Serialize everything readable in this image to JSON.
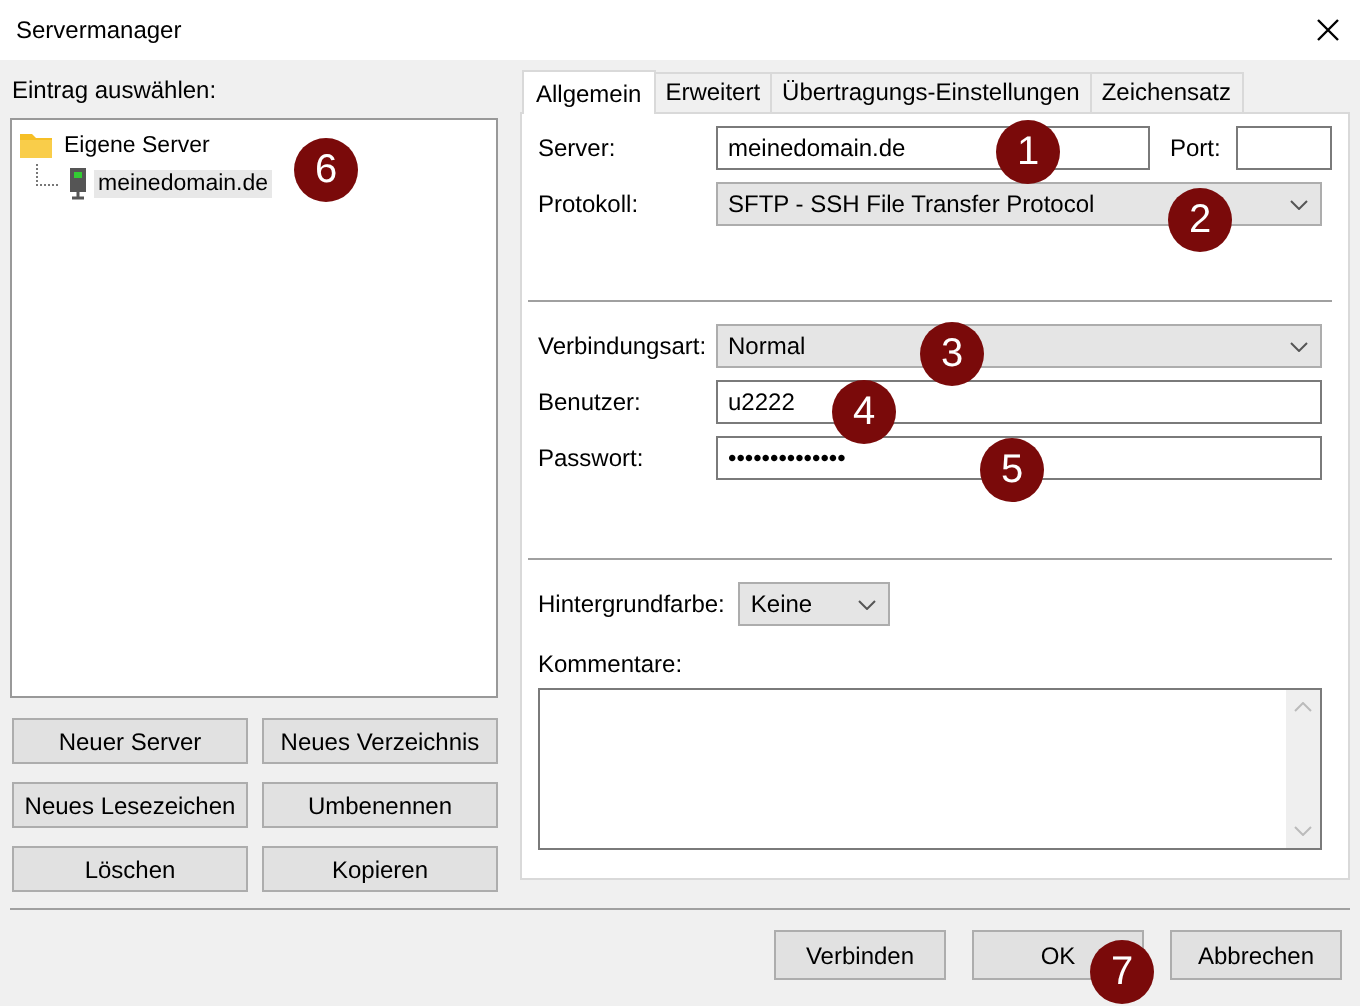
{
  "window": {
    "title": "Servermanager"
  },
  "entry_list": {
    "label": "Eintrag auswählen:",
    "tree": [
      {
        "label": "Eigene Server",
        "kind": "folder",
        "selected": false,
        "children": [
          {
            "label": "meinedomain.de",
            "kind": "server",
            "selected": true
          }
        ]
      }
    ]
  },
  "entry_buttons": [
    "Neuer Server",
    "Neues Verzeichnis",
    "Neues Lesezeichen",
    "Umbenennen",
    "Löschen",
    "Kopieren"
  ],
  "tabs": [
    {
      "label": "Allgemein",
      "selected": true
    },
    {
      "label": "Erweitert",
      "selected": false
    },
    {
      "label": "Übertragungs-Einstellungen",
      "selected": false
    },
    {
      "label": "Zeichensatz",
      "selected": false
    }
  ],
  "general": {
    "server": {
      "label": "Server:",
      "value": "meinedomain.de"
    },
    "port": {
      "label": "Port:"
    },
    "protocol": {
      "label": "Protokoll:",
      "value": "SFTP - SSH File Transfer Protocol"
    },
    "connection_type": {
      "label": "Verbindungsart:",
      "value": "Normal"
    },
    "user": {
      "label": "Benutzer:",
      "value": "u2222"
    },
    "password": {
      "label": "Passwort:",
      "value": "••••••••••••••"
    },
    "background_color": {
      "label": "Hintergrundfarbe:",
      "value": "Keine"
    },
    "comments": {
      "label": "Kommentare:"
    }
  },
  "dialog_buttons": [
    "Verbinden",
    "OK",
    "Abbrechen"
  ],
  "callouts": [
    "1",
    "2",
    "3",
    "4",
    "5",
    "6",
    "7"
  ]
}
